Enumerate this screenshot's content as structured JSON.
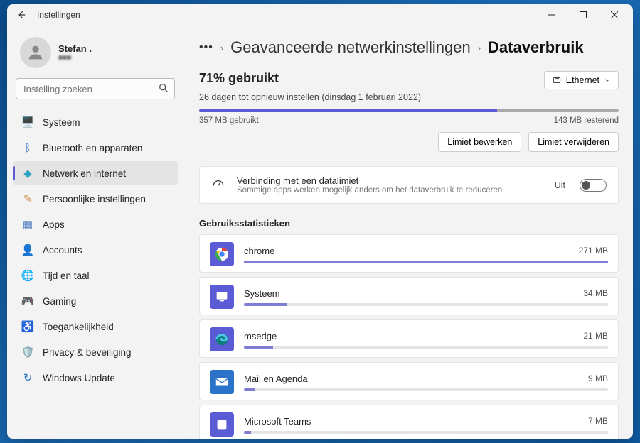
{
  "window_title": "Instellingen",
  "user": {
    "name": "Stefan .",
    "sub": "■■■"
  },
  "search": {
    "placeholder": "Instelling zoeken"
  },
  "sidebar": {
    "items": [
      {
        "label": "Systeem",
        "icon": "🖥️",
        "color": "#3a7dd8"
      },
      {
        "label": "Bluetooth en apparaten",
        "icon": "ᛒ",
        "color": "#2b73c9"
      },
      {
        "label": "Netwerk en internet",
        "icon": "◆",
        "color": "#2ea3c4",
        "active": true
      },
      {
        "label": "Persoonlijke instellingen",
        "icon": "✎",
        "color": "#c9893e"
      },
      {
        "label": "Apps",
        "icon": "▦",
        "color": "#4a7cbf"
      },
      {
        "label": "Accounts",
        "icon": "👤",
        "color": "#3a7dd8"
      },
      {
        "label": "Tijd en taal",
        "icon": "🌐",
        "color": "#5b8f3a"
      },
      {
        "label": "Gaming",
        "icon": "🎮",
        "color": "#6b6b6b"
      },
      {
        "label": "Toegankelijkheid",
        "icon": "♿",
        "color": "#3a7dd8"
      },
      {
        "label": "Privacy & beveiliging",
        "icon": "🛡️",
        "color": "#6b6b6b"
      },
      {
        "label": "Windows Update",
        "icon": "↻",
        "color": "#2b73c9"
      }
    ]
  },
  "breadcrumb": {
    "parent": "Geavanceerde netwerkinstellingen",
    "current": "Dataverbruik"
  },
  "usage": {
    "percent_label": "71% gebruikt",
    "reset_text": "26 dagen tot opnieuw instellen (dinsdag 1 februari 2022)",
    "used_label": "357 MB gebruikt",
    "remaining_label": "143 MB resterend",
    "percent": 71
  },
  "ethernet_button": "Ethernet",
  "limit": {
    "edit": "Limiet bewerken",
    "remove": "Limiet verwijderen"
  },
  "meter_card": {
    "title": "Verbinding met een datalimiet",
    "sub": "Sommige apps werken mogelijk anders om het dataverbruik te reduceren",
    "state": "Uit"
  },
  "stats_heading": "Gebruiksstatistieken",
  "apps": [
    {
      "name": "chrome",
      "amount": "271 MB",
      "pct": 100,
      "icon_bg": "#5b5bd6",
      "icon": "chrome"
    },
    {
      "name": "Systeem",
      "amount": "34 MB",
      "pct": 12,
      "icon_bg": "#5b5bd6",
      "icon": "system"
    },
    {
      "name": "msedge",
      "amount": "21 MB",
      "pct": 8,
      "icon_bg": "#5b5bd6",
      "icon": "edge"
    },
    {
      "name": "Mail en Agenda",
      "amount": "9 MB",
      "pct": 3,
      "icon_bg": "#2b73c9",
      "icon": "mail"
    },
    {
      "name": "Microsoft Teams",
      "amount": "7 MB",
      "pct": 2,
      "icon_bg": "#5b5bd6",
      "icon": "teams"
    }
  ]
}
